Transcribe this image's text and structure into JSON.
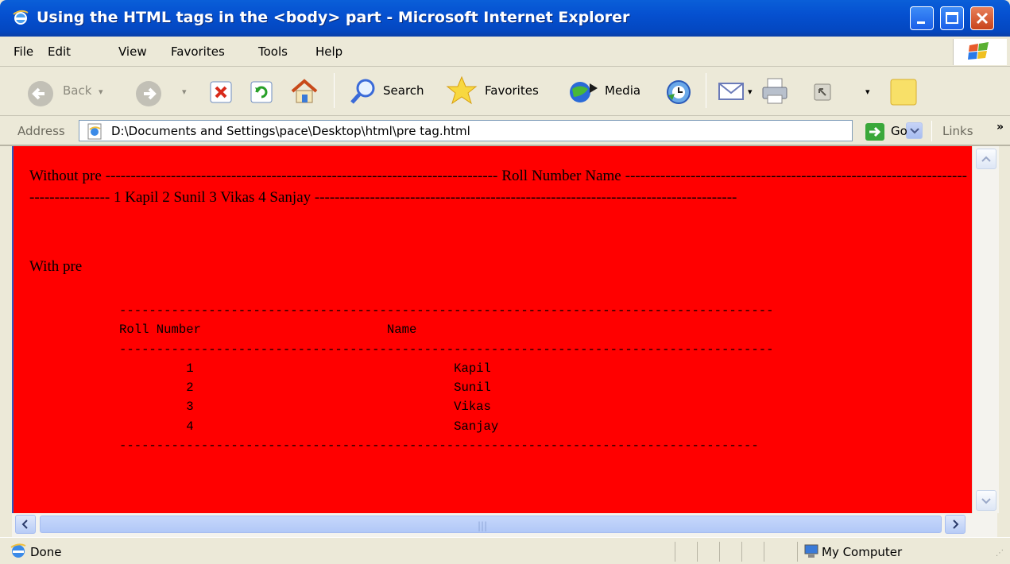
{
  "window": {
    "title": "Using the HTML tags in the <body> part - Microsoft Internet Explorer"
  },
  "menubar": {
    "items": [
      "File",
      "Edit",
      "View",
      "Favorites",
      "Tools",
      "Help"
    ]
  },
  "toolbar": {
    "back_label": "Back",
    "search_label": "Search",
    "favorites_label": "Favorites",
    "media_label": "Media"
  },
  "addressbar": {
    "label": "Address",
    "value": "D:\\Documents and Settings\\pace\\Desktop\\html\\pre tag.html",
    "go_label": "Go",
    "links_label": "Links"
  },
  "page": {
    "without_pre_text": "Without pre ------------------------------------------------------------------------------ Roll Number Name ------------------------------------------------------------------------------------ 1 Kapil 2 Sunil 3 Vikas 4 Sanjay ------------------------------------------------------------------------------------",
    "with_pre_label": "With pre",
    "pre_block": "----------------------------------------------------------------------------------------\nRoll Number                         Name\n----------------------------------------------------------------------------------------\n         1                                   Kapil\n         2                                   Sunil\n         3                                   Vikas\n         4                                   Sanjay\n--------------------------------------------------------------------------------------"
  },
  "statusbar": {
    "text": "Done",
    "zone": "My Computer"
  },
  "colors": {
    "page_background": "#ff0000",
    "titlebar": "#0550d0"
  }
}
